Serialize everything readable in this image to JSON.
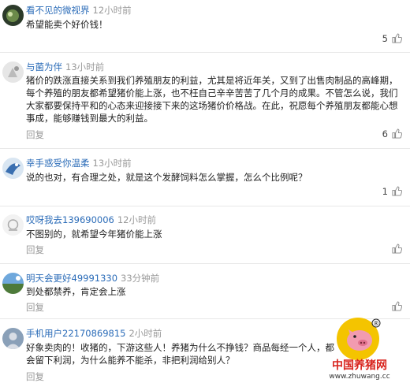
{
  "comments": [
    {
      "user": "看不见的微视界",
      "time": "12小时前",
      "text": "希望能卖个好价钱！",
      "reply": "",
      "likes": "5"
    },
    {
      "user": "与菌为伴",
      "time": "13小时前",
      "text": "猪价的跌涨直接关系到我们养殖朋友的利益，尤其是将近年关，又到了出售肉制品的高峰期，每个养殖的朋友都希望猪价能上涨，也不枉自己辛辛苦苦了几个月的成果。不管怎么说，我们大家都要保持平和的心态来迎接接下来的这场猪价价格战。在此，祝愿每个养殖朋友都能心想事成，能够赚钱到最大的利益。",
      "reply": "回复",
      "likes": "6"
    },
    {
      "user": "幸手惑受你温柔",
      "time": "13小时前",
      "text": "说的也对，有合理之处，就是这个发酵饲料怎么掌握，怎么个比例呢？",
      "reply": "",
      "likes": "1"
    },
    {
      "user": "哎呀我去139690006",
      "time": "12小时前",
      "text": "不图别的，就希望今年猪价能上涨",
      "reply": "回复",
      "likes": ""
    },
    {
      "user": "明天会更好49991330",
      "time": "33分钟前",
      "text": "到处都禁养，肯定会上涨",
      "reply": "回复",
      "likes": ""
    },
    {
      "user": "手机用户22170869815",
      "time": "2小时前",
      "text": "好象卖肉的！收猪的，下游这些人！养猪为什么不挣钱？商品每经一个人，都会留下利润，为什么能养不能杀，非把利润给别人？",
      "reply": "回复",
      "likes": ""
    }
  ],
  "watermark": {
    "site_cn": "中国养猪网",
    "site_url": "www.zhuwang.cc",
    "mark": "®"
  },
  "icons": {
    "thumb": "thumbs-up-icon"
  },
  "colors": {
    "user": "#2b6cb8",
    "muted": "#999999",
    "text": "#222222",
    "logo_red": "#d8231c",
    "logo_yellow": "#f4c400"
  }
}
